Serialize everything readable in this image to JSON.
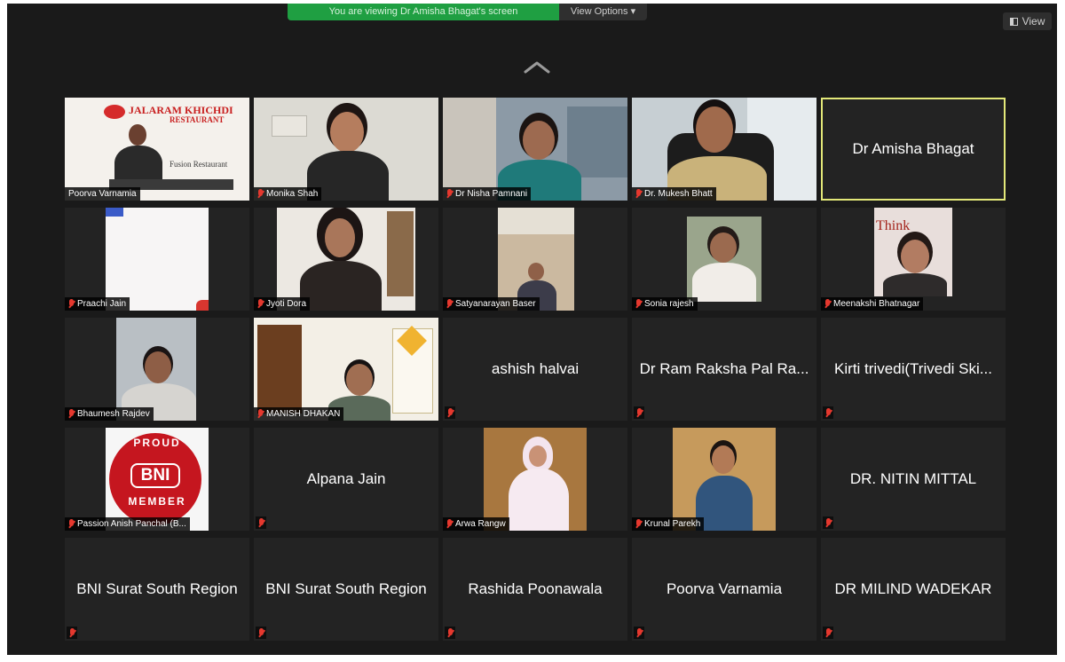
{
  "banner": {
    "sharing_text": "You are viewing Dr Amisha Bhagat's screen",
    "options_label": "View Options ▾"
  },
  "view_button": {
    "label": "View",
    "icon": "speaker-view-icon"
  },
  "collapse_icon": "chevron-up-icon",
  "colors": {
    "background": "#1a1a1a",
    "tile": "#232323",
    "active_speaker_border": "#e3e879",
    "muted_mic": "#e5382e",
    "sharing_banner": "#1f9f42"
  },
  "participants": [
    {
      "name": "Poorva Varnamia",
      "video": true,
      "muted": false,
      "slide_brand": "JALARAM KHICHDI",
      "slide_sub": "RESTAURANT",
      "slide_text": "Fusion Restaurant"
    },
    {
      "name": "Monika Shah",
      "video": true,
      "muted": true
    },
    {
      "name": "Dr Nisha Pamnani",
      "video": true,
      "muted": true
    },
    {
      "name": "Dr. Mukesh Bhatt",
      "video": true,
      "muted": true
    },
    {
      "name": "Dr Amisha Bhagat",
      "video": false,
      "muted": false,
      "active_speaker": true
    },
    {
      "name": "Praachi Jain",
      "video": true,
      "muted": true
    },
    {
      "name": "Jyoti Dora",
      "video": true,
      "muted": true
    },
    {
      "name": "Satyanarayan Baser",
      "video": true,
      "muted": true
    },
    {
      "name": "Sonia rajesh",
      "video": true,
      "muted": true
    },
    {
      "name": "Meenakshi Bhatnagar",
      "video": true,
      "muted": true,
      "bg_text": "Think"
    },
    {
      "name": "Bhaumesh Rajdev",
      "video": true,
      "muted": true
    },
    {
      "name": "MANISH DHAKAN",
      "video": true,
      "muted": true
    },
    {
      "name": "ashish halvai",
      "video": false,
      "muted": true
    },
    {
      "name": "Dr Ram Raksha Pal Ra...",
      "video": false,
      "muted": true
    },
    {
      "name": "Kirti trivedi(Trivedi Ski...",
      "video": false,
      "muted": true
    },
    {
      "name": "Passion Anish Panchal (B...",
      "video": true,
      "muted": true,
      "badge_top": "PROUD",
      "badge_mid": "BNI",
      "badge_bottom": "MEMBER"
    },
    {
      "name": "Alpana Jain",
      "video": false,
      "muted": true
    },
    {
      "name": "Arwa Rangw",
      "video": true,
      "muted": true
    },
    {
      "name": "Krunal Parekh",
      "video": true,
      "muted": true
    },
    {
      "name": "DR. NITIN MITTAL",
      "video": false,
      "muted": true
    },
    {
      "name": "BNI Surat South Region",
      "video": false,
      "muted": true
    },
    {
      "name": "BNI Surat South Region",
      "video": false,
      "muted": true
    },
    {
      "name": "Rashida Poonawala",
      "video": false,
      "muted": true
    },
    {
      "name": "Poorva Varnamia",
      "video": false,
      "muted": true
    },
    {
      "name": "DR MILIND WADEKAR",
      "video": false,
      "muted": true
    }
  ]
}
